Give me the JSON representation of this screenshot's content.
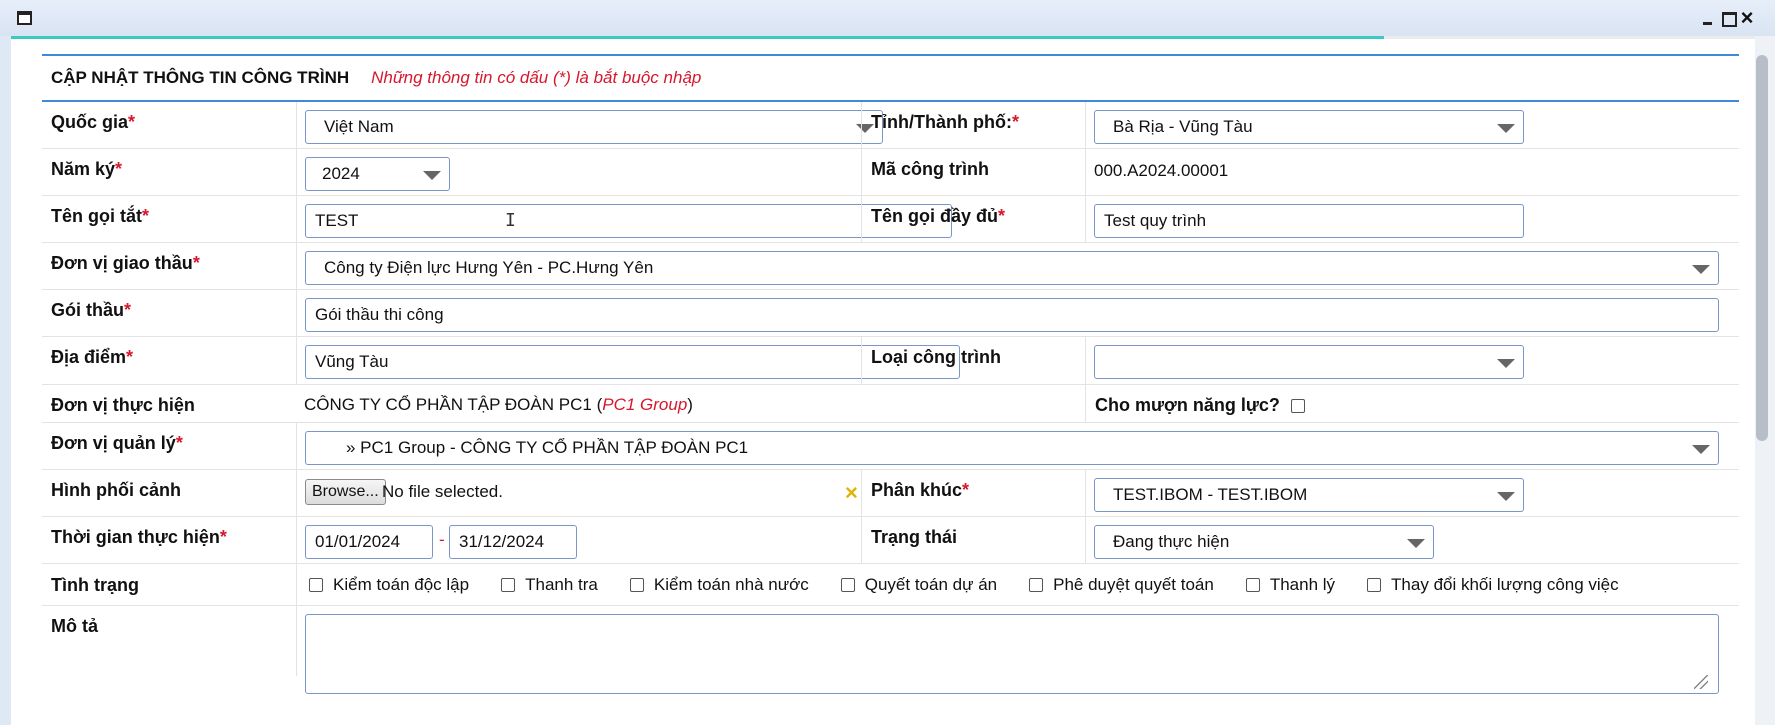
{
  "window": {
    "icon": "window-icon",
    "controls": {
      "minimize": "minimize-icon",
      "maximize": "maximize-icon",
      "close": "×"
    }
  },
  "progress": {
    "value_percent": 78.7,
    "color": "#3fc7c1"
  },
  "form": {
    "title": "CẬP NHẬT THÔNG TIN CÔNG TRÌNH",
    "note": "Những thông tin có dấu (*) là bắt buộc nhập",
    "required_mark": "*",
    "accent_color": "#3e8ad6",
    "required_color": "#d6172c",
    "fields": {
      "quoc_gia": {
        "label": "Quốc gia",
        "value": "Việt Nam"
      },
      "tinh_thanh": {
        "label": "Tỉnh/Thành phố:",
        "value": "Bà Rịa - Vũng Tàu"
      },
      "nam_ky": {
        "label": "Năm ký",
        "value": "2024"
      },
      "ma_cong_trinh": {
        "label": "Mã công trình",
        "value": "000.A2024.00001"
      },
      "ten_goi_tat": {
        "label": "Tên gọi tắt",
        "value": "TEST"
      },
      "ten_goi_day_du": {
        "label": "Tên gọi đầy đủ",
        "value": "Test quy trình"
      },
      "don_vi_giao_thau": {
        "label": "Đơn vị giao thầu",
        "value": "Công ty Điện lực Hưng Yên - PC.Hưng Yên"
      },
      "goi_thau": {
        "label": "Gói thầu",
        "value": "Gói thầu thi công"
      },
      "dia_diem": {
        "label": "Địa điểm",
        "value": "Vũng Tàu"
      },
      "loai_cong_trinh": {
        "label": "Loại công trình",
        "value": ""
      },
      "don_vi_thuc_hien": {
        "label": "Đơn vị thực hiện",
        "value": "CÔNG TY CỔ PHẦN TẬP ĐOÀN PC1",
        "paren_open": "(",
        "short_name": "PC1 Group",
        "paren_close": ")"
      },
      "cho_muon_nang_luc": {
        "label": "Cho mượn năng lực?",
        "checked": false
      },
      "don_vi_quan_ly": {
        "label": "Đơn vị quản lý",
        "value": "» PC1 Group - CÔNG TY CỔ PHẦN TẬP ĐOÀN PC1"
      },
      "hinh_phoi_canh": {
        "label": "Hình phối cảnh",
        "browse_label": "Browse...",
        "file_status": "No file selected.",
        "clear_icon": "×"
      },
      "phan_khuc": {
        "label": "Phân khúc",
        "value": "TEST.IBOM - TEST.IBOM"
      },
      "thoi_gian": {
        "label": "Thời gian thực hiện",
        "start": "01/01/2024",
        "separator": "-",
        "end": "31/12/2024"
      },
      "trang_thai": {
        "label": "Trạng thái",
        "value": "Đang thực hiện"
      },
      "tinh_trang": {
        "label": "Tình trạng",
        "options": [
          {
            "label": "Kiểm toán độc lập",
            "checked": false
          },
          {
            "label": "Thanh tra",
            "checked": false
          },
          {
            "label": "Kiểm toán nhà nước",
            "checked": false
          },
          {
            "label": "Quyết toán dự án",
            "checked": false
          },
          {
            "label": "Phê duyệt quyết toán",
            "checked": false
          },
          {
            "label": "Thanh lý",
            "checked": false
          },
          {
            "label": "Thay đổi khối lượng công việc",
            "checked": false
          }
        ]
      },
      "mo_ta": {
        "label": "Mô tả",
        "value": ""
      }
    }
  },
  "cursor_glyph": "I"
}
